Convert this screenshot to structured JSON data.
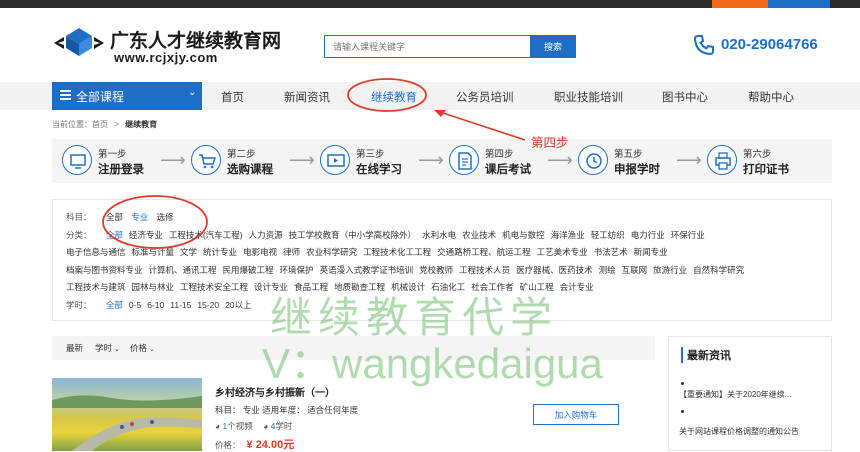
{
  "header": {
    "logo_cn": "广东人才继续教育网",
    "logo_url": "www.rcjxjy.com",
    "search_placeholder": "请输入课程关键字",
    "search_button": "搜索",
    "phone": "020-29064766"
  },
  "nav": {
    "all_categories": "全部课程",
    "items": [
      "首页",
      "新闻资讯",
      "继续教育",
      "公务员培训",
      "职业技能培训",
      "图书中心",
      "帮助中心"
    ]
  },
  "breadcrumb": {
    "prefix": "当前位置：",
    "home": "首页",
    "sep": ">",
    "current": "继续教育"
  },
  "steps": [
    {
      "num": "第一步",
      "name": "注册登录"
    },
    {
      "num": "第二步",
      "name": "选购课程"
    },
    {
      "num": "第三步",
      "name": "在线学习"
    },
    {
      "num": "第四步",
      "name": "课后考试"
    },
    {
      "num": "第五步",
      "name": "申报学时"
    },
    {
      "num": "第六步",
      "name": "打印证书"
    }
  ],
  "filters": {
    "subject_label": "科目：",
    "subjects": [
      "全部",
      "专业",
      "选修"
    ],
    "category_label": "分类：",
    "category_rows": [
      [
        "全部",
        "经济专业",
        "工程技术(汽车工程)",
        "人力资源",
        "技工学校教育（中小学高校除外）",
        "水利水电",
        "农业技术",
        "机电与数控",
        "海洋渔业",
        "轻工纺织",
        "电力行业",
        "环保行业"
      ],
      [
        "电子信息与通信",
        "标准与计量",
        "文学",
        "统计专业",
        "电影电视",
        "律师",
        "农业科学研究",
        "工程技术化工工程",
        "交通路桥工程、航运工程",
        "工艺美术专业",
        "书法艺术",
        "新闻专业"
      ],
      [
        "档案与图书资料专业",
        "计算机、通讯工程",
        "民用爆破工程",
        "环境保护",
        "英语漫入式教学证书培训",
        "党校教师",
        "工程技术人员",
        "医疗器械、医药技术",
        "测绘",
        "互联网",
        "旅游行业",
        "自然科学研究"
      ],
      [
        "工程技术与建筑",
        "园林与林业",
        "工程技术安全工程",
        "设计专业",
        "食品工程",
        "地质勘查工程",
        "机械设计",
        "石油化工",
        "社会工作者",
        "矿山工程",
        "会计专业"
      ]
    ],
    "hours_label": "学时：",
    "hours": [
      "全部",
      "0-5",
      "6-10",
      "11-15",
      "15-20",
      "20以上"
    ]
  },
  "sort": {
    "latest": "最新",
    "hours": "学时",
    "price": "价格"
  },
  "course": {
    "title": "乡村经济与乡村振新（一）",
    "meta": "科目：  专业   适用年度：  适合任何年度",
    "videos": "1",
    "videos_unit": "个视频",
    "hours": "4",
    "hours_unit": "学时",
    "price_label": "价格：",
    "price": "¥ 24.00元",
    "cart_button": "加入购物车"
  },
  "news": {
    "heading": "最新资讯",
    "items": [
      "【重要通知】关于2020年继续...",
      "关于网站课程价格调整的通知公告"
    ]
  },
  "annotation": {
    "label": "第四步",
    "color": "#e23a2a"
  },
  "watermark": {
    "line1": "继续教育代学",
    "line2": "V：wangkedaigua"
  },
  "colors": {
    "brand": "#1e6ec8",
    "accent_orange": "#f26a1b",
    "price": "#e23a2a"
  }
}
